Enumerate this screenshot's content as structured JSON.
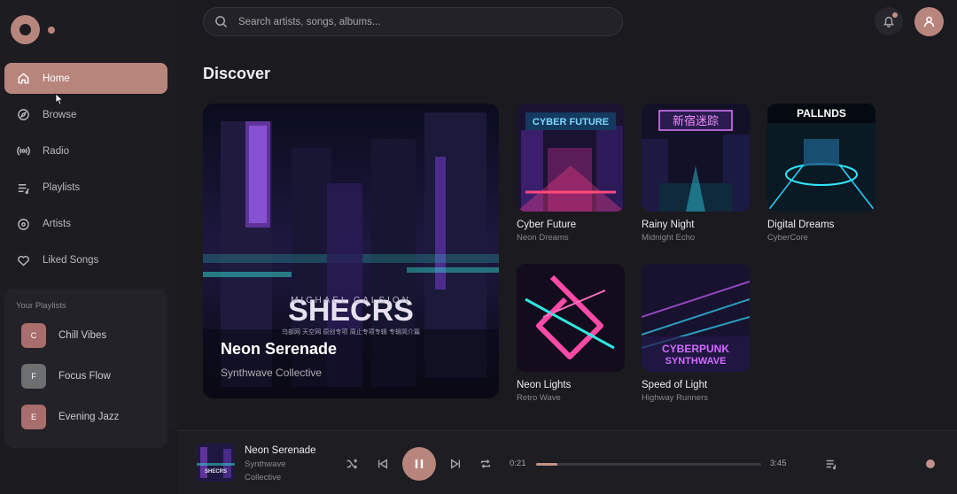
{
  "sidebar": {
    "nav": [
      {
        "label": "Home",
        "icon": "home-icon",
        "active": true
      },
      {
        "label": "Browse",
        "icon": "compass-icon",
        "active": false
      },
      {
        "label": "Radio",
        "icon": "radio-icon",
        "active": false
      },
      {
        "label": "Playlists",
        "icon": "playlist-icon",
        "active": false
      },
      {
        "label": "Artists",
        "icon": "disc-icon",
        "active": false
      },
      {
        "label": "Liked Songs",
        "icon": "heart-icon",
        "active": false
      }
    ],
    "your_playlists_title": "Your Playlists",
    "playlists": [
      {
        "label": "Chill Vibes",
        "letter": "C",
        "color": "#a86e6b"
      },
      {
        "label": "Focus Flow",
        "letter": "F",
        "color": "#6d6f70"
      },
      {
        "label": "Evening Jazz",
        "letter": "E",
        "color": "#a86e6b"
      }
    ]
  },
  "header": {
    "search_placeholder": "Search artists, songs, albums..."
  },
  "discover": {
    "title": "Discover",
    "featured": {
      "art_text": "SHECRS",
      "art_subtext": "MICHAEL CALSION",
      "art_tagline": "乌部网   天空网   原创专项   周止专项专辑   专辑简介篇",
      "title": "Neon Serenade",
      "artist": "Synthwave Collective"
    },
    "cards": [
      {
        "title": "Cyber Future",
        "artist": "Neon Dreams",
        "art_text": "CYBER FUTURE"
      },
      {
        "title": "Rainy Night",
        "artist": "Midnight Echo",
        "art_text": "新宿迷踪"
      },
      {
        "title": "Digital Dreams",
        "artist": "CyberCore",
        "art_text": "PALLNDS"
      },
      {
        "title": "Neon Lights",
        "artist": "Retro Wave",
        "art_text": ""
      },
      {
        "title": "Speed of Light",
        "artist": "Highway Runners",
        "art_text_1": "CYBERPUNK",
        "art_text_2": "SYNTHWAVE"
      }
    ]
  },
  "player": {
    "title": "Neon Serenade",
    "artist_line1": "Synthwave",
    "artist_line2": "Collective",
    "thumb_text": "SHECRS",
    "elapsed": "0:21",
    "duration": "3:45",
    "progress": 0.093
  },
  "colors": {
    "accent": "#b8857c",
    "background": "#1a1a1f"
  }
}
